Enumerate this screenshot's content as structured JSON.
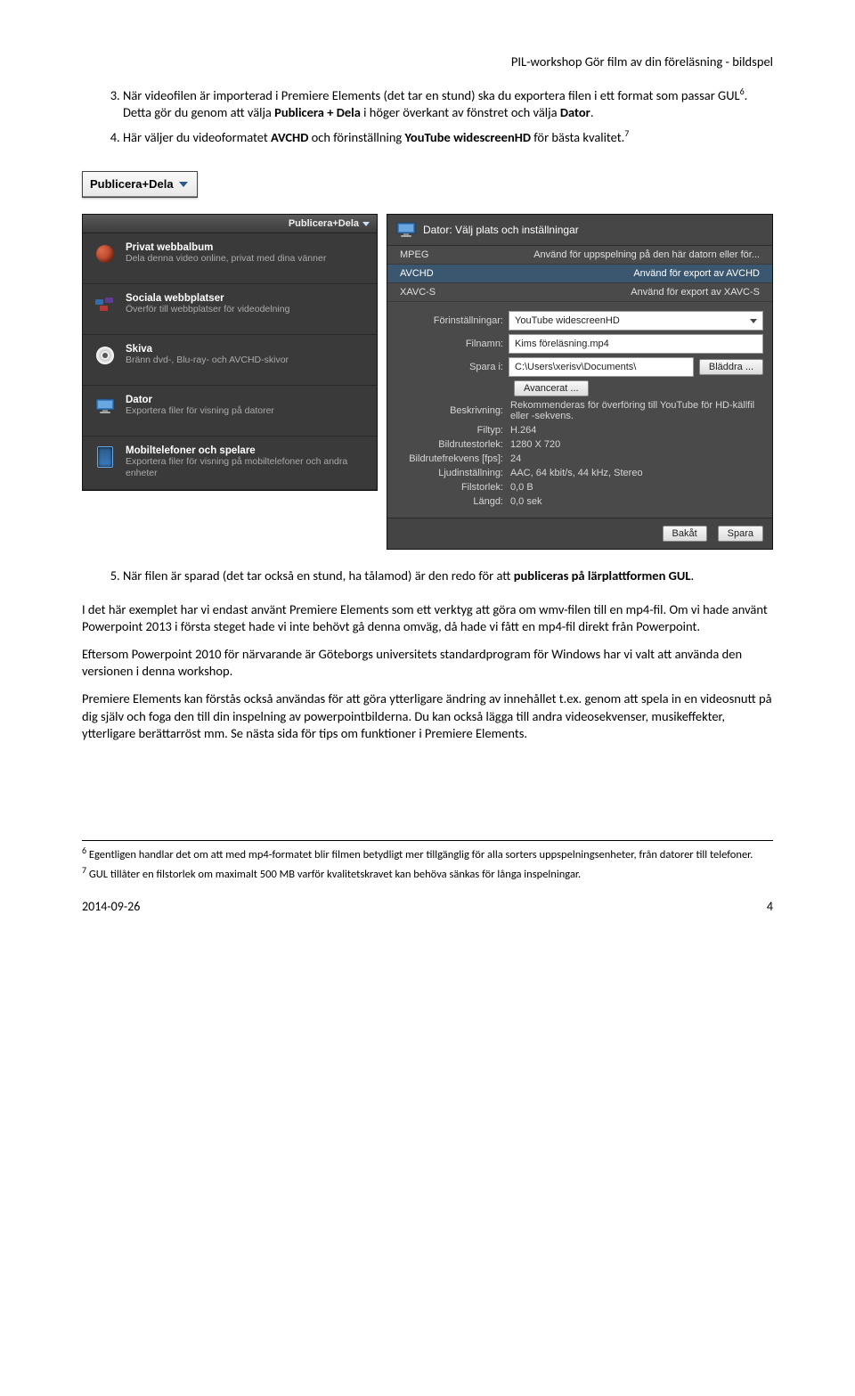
{
  "header": "PIL-workshop Gör film av din föreläsning - bildspel",
  "steps": {
    "s3_a": "När videofilen är importerad i Premiere Elements (det tar en stund) ska du exportera filen i ett format som passar GUL",
    "s3_b": ". Detta gör du genom att välja ",
    "s3_bold1": "Publicera + Dela",
    "s3_c": " i höger överkant av fönstret och välja ",
    "s3_bold2": "Dator",
    "s3_d": ".",
    "s4_a": "Här väljer du videoformatet ",
    "s4_bold1": "AVCHD",
    "s4_b": " och förinställning ",
    "s4_bold2": "YouTube widescreenHD",
    "s4_c": " för bästa kvalitet.",
    "s5_a": "När filen är sparad (det tar också en stund, ha tålamod) är den redo för att ",
    "s5_bold": "publiceras på lärplattformen GUL",
    "s5_b": "."
  },
  "fn": {
    "n6": "6",
    "n7": "7",
    "t6": " Egentligen handlar det om att med mp4-formatet blir filmen betydligt mer tillgänglig för alla sorters uppspelningsenheter, från datorer till telefoner.",
    "t7": " GUL tillåter en filstorlek om maximalt 500 MB varför kvalitetskravet kan behöva sänkas för långa inspelningar."
  },
  "dropdown_tab": "Publicera+Dela",
  "leftpanel": {
    "tab": "Publicera+Dela",
    "items": [
      {
        "title": "Privat webbalbum",
        "sub": "Dela denna video online, privat med dina vänner"
      },
      {
        "title": "Sociala webbplatser",
        "sub": "Överför till webbplatser för videodelning"
      },
      {
        "title": "Skiva",
        "sub": "Bränn dvd-, Blu-ray- och AVCHD-skivor"
      },
      {
        "title": "Dator",
        "sub": "Exportera filer för visning på datorer"
      },
      {
        "title": "Mobiltelefoner och spelare",
        "sub": "Exportera filer för visning på mobiltelefoner och andra enheter"
      }
    ]
  },
  "rightpanel": {
    "header": "Dator: Välj plats och inställningar",
    "rows": [
      {
        "l": "MPEG",
        "r": "Använd för uppspelning på den här datorn eller för..."
      },
      {
        "l": "AVCHD",
        "r": "Använd för export av AVCHD"
      },
      {
        "l": "XAVC-S",
        "r": "Använd för export av XAVC-S"
      }
    ],
    "labels": {
      "preset": "Förinställningar:",
      "filename": "Filnamn:",
      "savein": "Spara i:",
      "browse": "Bläddra ...",
      "advanced": "Avancerat ...",
      "desc": "Beskrivning:",
      "filetype": "Filtyp:",
      "framesize": "Bildrutestorlek:",
      "framerate": "Bildrutefrekvens [fps]:",
      "audio": "Ljudinställning:",
      "filesize": "Filstorlek:",
      "length": "Längd:",
      "back": "Bakåt",
      "save": "Spara"
    },
    "vals": {
      "preset": "YouTube widescreenHD",
      "filename": "Kims föreläsning.mp4",
      "savein": "C:\\Users\\xerisv\\Documents\\",
      "desc": "Rekommenderas för överföring till YouTube för HD-källfil eller -sekvens.",
      "filetype": "H.264",
      "framesize": "1280 X 720",
      "framerate": "24",
      "audio": "AAC, 64 kbit/s, 44 kHz, Stereo",
      "filesize": "0,0 B",
      "length": "0,0 sek"
    }
  },
  "para": {
    "p1": "I det här exemplet har vi endast använt Premiere Elements som ett verktyg att göra om wmv-filen till en mp4-fil. Om vi hade använt Powerpoint 2013 i första steget hade vi inte behövt gå denna omväg, då hade vi fått en mp4-fil direkt från Powerpoint.",
    "p2": "Eftersom Powerpoint 2010 för närvarande är Göteborgs universitets standardprogram för Windows har vi valt att använda den versionen i denna workshop.",
    "p3": "Premiere Elements kan förstås också användas för att göra ytterligare ändring av innehållet t.ex. genom att spela in en videosnutt på dig själv och foga den till din inspelning av powerpointbilderna. Du kan också lägga till andra videosekvenser, musikeffekter, ytterligare berättarröst mm. Se nästa sida för tips om funktioner i Premiere Elements."
  },
  "footer": {
    "date": "2014-09-26",
    "page": "4"
  }
}
